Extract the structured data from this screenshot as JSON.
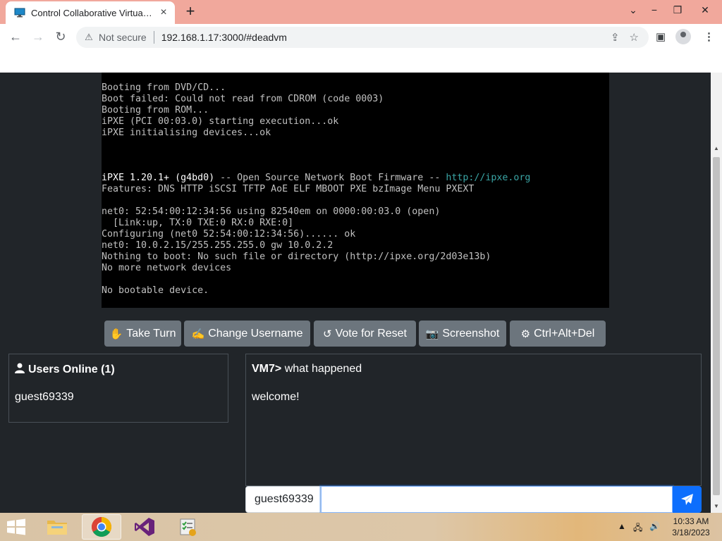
{
  "browser": {
    "tab_title": "Control Collaborative Virtual Machine",
    "new_tab_icon": "plus-icon",
    "security_label": "Not secure",
    "url": "192.168.1.17:3000/#deadvm"
  },
  "terminal": {
    "lines": [
      {
        "text": "Booting from DVD/CD..."
      },
      {
        "text": "Boot failed: Could not read from CDROM (code 0003)"
      },
      {
        "text": "Booting from ROM..."
      },
      {
        "text": "iPXE (PCI 00:03.0) starting execution...ok"
      },
      {
        "text": "iPXE initialising devices...ok"
      },
      {
        "text": ""
      },
      {
        "text": ""
      },
      {
        "text": ""
      },
      {
        "text": "iPXE 1.20.1+ (g4bd0) -- Open Source Network Boot Firmware -- ",
        "bright_prefix": "iPXE 1.20.1+ (g4bd0)",
        "link": "http://ipxe.org"
      },
      {
        "text": "Features: DNS HTTP iSCSI TFTP AoE ELF MBOOT PXE bzImage Menu PXEXT"
      },
      {
        "text": ""
      },
      {
        "text": "net0: 52:54:00:12:34:56 using 82540em on 0000:00:03.0 (open)"
      },
      {
        "text": "  [Link:up, TX:0 TXE:0 RX:0 RXE:0]"
      },
      {
        "text": "Configuring (net0 52:54:00:12:34:56)...... ok"
      },
      {
        "text": "net0: 10.0.2.15/255.255.255.0 gw 10.0.2.2"
      },
      {
        "text": "Nothing to boot: No such file or directory (http://ipxe.org/2d03e13b)"
      },
      {
        "text": "No more network devices"
      },
      {
        "text": ""
      },
      {
        "text": "No bootable device."
      }
    ]
  },
  "vm_buttons": [
    {
      "label": "Take Turn",
      "icon": "hand-icon",
      "glyph": "✋"
    },
    {
      "label": "Change Username",
      "icon": "person-icon",
      "glyph": "✍"
    },
    {
      "label": "Vote for Reset",
      "icon": "undo-icon",
      "glyph": "↺"
    },
    {
      "label": "Screenshot",
      "icon": "camera-icon",
      "glyph": "📷"
    },
    {
      "label": "Ctrl+Alt+Del",
      "icon": "gear-icon",
      "glyph": "⚙"
    }
  ],
  "users": {
    "title": "Users Online (1)",
    "list": [
      "guest69339"
    ]
  },
  "chat": {
    "messages": [
      {
        "user": "VM7>",
        "text": " what happened"
      },
      {
        "user": "",
        "text": "welcome!"
      }
    ],
    "username": "guest69339",
    "input_value": ""
  },
  "taskbar": {
    "time": "10:33 AM",
    "date": "3/18/2023"
  },
  "colors": {
    "page_bg": "#212529",
    "button_bg": "#6c757d",
    "send_bg": "#0d6efd"
  }
}
